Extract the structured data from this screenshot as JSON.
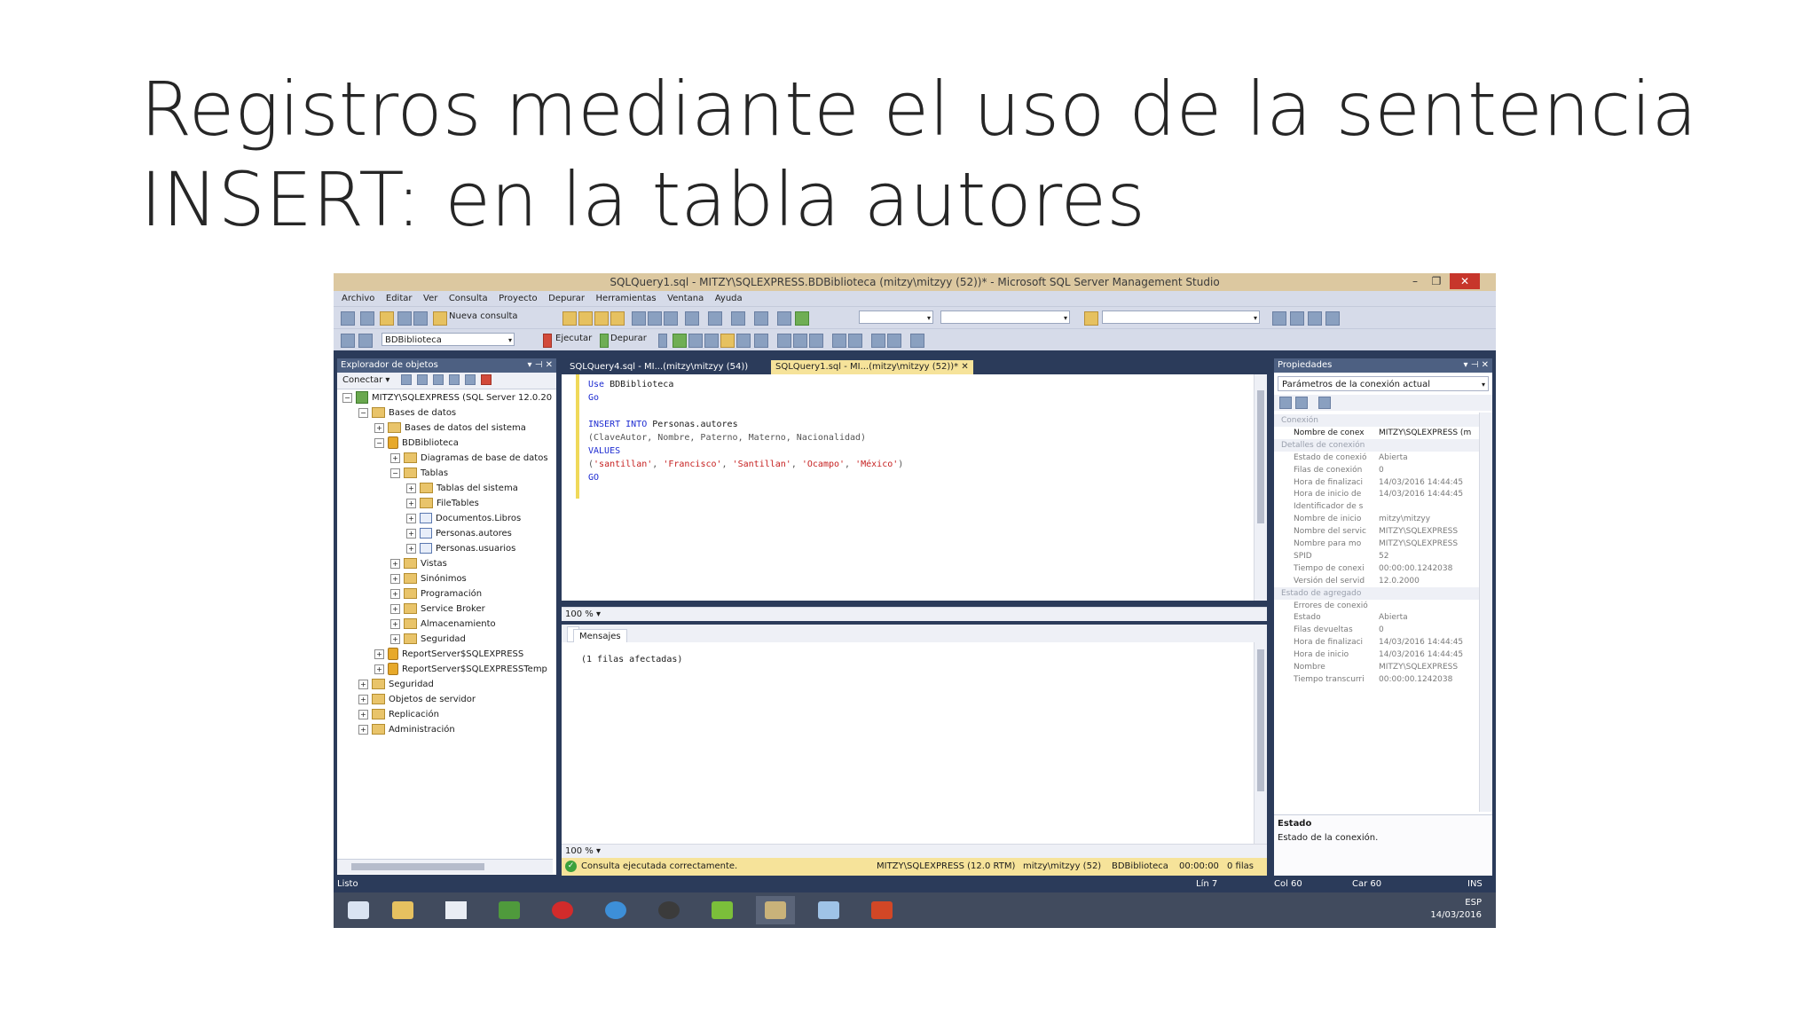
{
  "slide": {
    "title_line1": "Registros mediante el uso de la sentencia",
    "title_line2": "INSERT: en la tabla autores"
  },
  "window": {
    "title": "SQLQuery1.sql - MITZY\\SQLEXPRESS.BDBiblioteca (mitzy\\mitzyy (52))* - Microsoft SQL Server Management Studio"
  },
  "menu": [
    "Archivo",
    "Editar",
    "Ver",
    "Consulta",
    "Proyecto",
    "Depurar",
    "Herramientas",
    "Ventana",
    "Ayuda"
  ],
  "toolbar": {
    "new_query": "Nueva consulta",
    "database": "BDBiblioteca",
    "execute": "Ejecutar",
    "debug": "Depurar"
  },
  "object_explorer": {
    "title": "Explorador de objetos",
    "connect": "Conectar",
    "nodes": [
      {
        "label": "MITZY\\SQLEXPRESS (SQL Server 12.0.20",
        "level": 0,
        "exp": "−",
        "icon": "srv"
      },
      {
        "label": "Bases de datos",
        "level": 1,
        "exp": "−",
        "icon": "fold"
      },
      {
        "label": "Bases de datos del sistema",
        "level": 2,
        "exp": "+",
        "icon": "fold"
      },
      {
        "label": "BDBiblioteca",
        "level": 2,
        "exp": "−",
        "icon": "db"
      },
      {
        "label": "Diagramas de base de datos",
        "level": 3,
        "exp": "+",
        "icon": "fold"
      },
      {
        "label": "Tablas",
        "level": 3,
        "exp": "−",
        "icon": "fold"
      },
      {
        "label": "Tablas del sistema",
        "level": 4,
        "exp": "+",
        "icon": "fold"
      },
      {
        "label": "FileTables",
        "level": 4,
        "exp": "+",
        "icon": "fold"
      },
      {
        "label": "Documentos.Libros",
        "level": 4,
        "exp": "+",
        "icon": "tbl"
      },
      {
        "label": "Personas.autores",
        "level": 4,
        "exp": "+",
        "icon": "tbl"
      },
      {
        "label": "Personas.usuarios",
        "level": 4,
        "exp": "+",
        "icon": "tbl"
      },
      {
        "label": "Vistas",
        "level": 3,
        "exp": "+",
        "icon": "fold"
      },
      {
        "label": "Sinónimos",
        "level": 3,
        "exp": "+",
        "icon": "fold"
      },
      {
        "label": "Programación",
        "level": 3,
        "exp": "+",
        "icon": "fold"
      },
      {
        "label": "Service Broker",
        "level": 3,
        "exp": "+",
        "icon": "fold"
      },
      {
        "label": "Almacenamiento",
        "level": 3,
        "exp": "+",
        "icon": "fold"
      },
      {
        "label": "Seguridad",
        "level": 3,
        "exp": "+",
        "icon": "fold"
      },
      {
        "label": "ReportServer$SQLEXPRESS",
        "level": 2,
        "exp": "+",
        "icon": "db"
      },
      {
        "label": "ReportServer$SQLEXPRESSTemp",
        "level": 2,
        "exp": "+",
        "icon": "db"
      },
      {
        "label": "Seguridad",
        "level": 1,
        "exp": "+",
        "icon": "fold"
      },
      {
        "label": "Objetos de servidor",
        "level": 1,
        "exp": "+",
        "icon": "fold"
      },
      {
        "label": "Replicación",
        "level": 1,
        "exp": "+",
        "icon": "fold"
      },
      {
        "label": "Administración",
        "level": 1,
        "exp": "+",
        "icon": "fold"
      }
    ]
  },
  "tabs": [
    {
      "label": "SQLQuery4.sql - MI...(mitzy\\mitzyy (54))",
      "active": false
    },
    {
      "label": "SQLQuery1.sql - MI...(mitzy\\mitzyy (52))*",
      "active": true
    }
  ],
  "editor": {
    "use_kw": "Use",
    "use_db": "BDBiblioteca",
    "go1": "Go",
    "insert_kw": "INSERT INTO",
    "insert_table": "Personas.autores",
    "columns": "(ClaveAutor, Nombre, Paterno, Materno, Nacionalidad)",
    "values_kw": "VALUES",
    "values_open": "(",
    "v1": "'santillan'",
    "v2": "'Francisco'",
    "v3": "'Santillan'",
    "v4": "'Ocampo'",
    "v5": "'México'",
    "sep": ", ",
    "values_close": ")",
    "go2": "GO",
    "zoom": "100 %"
  },
  "results": {
    "tab": "Mensajes",
    "message": "(1 filas afectadas)",
    "zoom": "100 %"
  },
  "query_status": {
    "message": "Consulta ejecutada correctamente.",
    "server": "MITZY\\SQLEXPRESS (12.0 RTM)",
    "user": "mitzy\\mitzyy (52)",
    "db": "BDBiblioteca",
    "time": "00:00:00",
    "rows": "0 filas"
  },
  "properties": {
    "title": "Propiedades",
    "selector": "Parámetros de la conexión actual",
    "rows": [
      {
        "k": "Conexión",
        "v": "",
        "cat": true
      },
      {
        "k": "Nombre de conex",
        "v": "MITZY\\SQLEXPRESS (m",
        "dark": true
      },
      {
        "k": "Detalles de conexión",
        "v": "",
        "cat": true
      },
      {
        "k": "Estado de conexió",
        "v": "Abierta"
      },
      {
        "k": "Filas de conexión",
        "v": "0"
      },
      {
        "k": "Hora de finalizaci",
        "v": "14/03/2016 14:44:45"
      },
      {
        "k": "Hora de inicio de",
        "v": "14/03/2016 14:44:45"
      },
      {
        "k": "Identificador de s",
        "v": ""
      },
      {
        "k": "Nombre de inicio",
        "v": "mitzy\\mitzyy"
      },
      {
        "k": "Nombre del servic",
        "v": "MITZY\\SQLEXPRESS"
      },
      {
        "k": "Nombre para mo",
        "v": "MITZY\\SQLEXPRESS"
      },
      {
        "k": "SPID",
        "v": "52"
      },
      {
        "k": "Tiempo de conexi",
        "v": "00:00:00.1242038"
      },
      {
        "k": "Versión del servid",
        "v": "12.0.2000"
      },
      {
        "k": "Estado de agregado",
        "v": "",
        "cat": true
      },
      {
        "k": "Errores de conexió",
        "v": ""
      },
      {
        "k": "Estado",
        "v": "Abierta"
      },
      {
        "k": "Filas devueltas",
        "v": "0"
      },
      {
        "k": "Hora de finalizaci",
        "v": "14/03/2016 14:44:45"
      },
      {
        "k": "Hora de inicio",
        "v": "14/03/2016 14:44:45"
      },
      {
        "k": "Nombre",
        "v": "MITZY\\SQLEXPRESS"
      },
      {
        "k": "Tiempo transcurri",
        "v": "00:00:00.1242038"
      }
    ],
    "desc_title": "Estado",
    "desc_text": "Estado de la conexión."
  },
  "statusbar": {
    "ready": "Listo",
    "ln": "Lín 7",
    "col": "Col 60",
    "car": "Car 60",
    "ins": "INS"
  },
  "taskbar": {
    "lang": "ESP",
    "date": "14/03/2016"
  },
  "colors": {
    "slide_title": "#262626",
    "vs_dark": "#2b3b5a",
    "active_tab": "#f6e39a",
    "keyword": "#1d2bd1",
    "string": "#c62020"
  }
}
